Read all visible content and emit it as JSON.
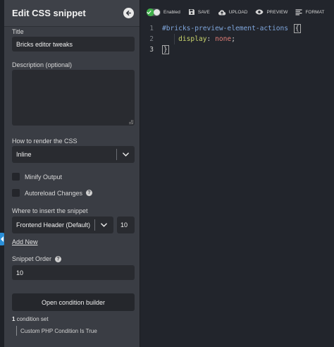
{
  "panel": {
    "title": "Edit CSS snippet",
    "title_label": "Title",
    "title_value": "Bricks editor tweaks",
    "description_label": "Description (optional)",
    "description_value": "",
    "render_label": "How to render the CSS",
    "render_value": "Inline",
    "minify_label": "Minify Output",
    "autoreload_label": "Autoreload Changes",
    "insert_label": "Where to insert the snippet",
    "insert_value": "Frontend Header (Default)",
    "insert_priority": "10",
    "add_new": "Add New",
    "order_label": "Snippet Order",
    "order_value": "10",
    "condition_button": "Open condition builder",
    "condition_count": "1",
    "condition_count_suffix": " condition set",
    "condition_item": "Custom PHP Condition Is True",
    "help_glyph": "?"
  },
  "toolbar": {
    "enabled_label": "Enabled",
    "enabled": true,
    "save_label": "SAVE",
    "upload_label": "UPLOAD",
    "preview_label": "PREVIEW",
    "format_label": "FORMAT"
  },
  "code": {
    "line_numbers": [
      "1",
      "2",
      "3"
    ],
    "selector": "#bricks-preview-element-actions",
    "open_brace": "{",
    "indent": "    ",
    "property": "display",
    "colon": ":",
    "value": "none",
    "semicolon": ";",
    "close_brace": "}"
  },
  "colors": {
    "accent_green": "#3fae49",
    "edge_tab_blue": "#2a8fd8",
    "selector": "#7fa6dc",
    "property": "#c8d36b",
    "value": "#e07d76"
  },
  "icons": [
    "back-arrow-icon",
    "save-icon",
    "upload-cloud-icon",
    "eye-icon",
    "format-lines-icon",
    "chevron-down-icon",
    "help-icon",
    "checkmark-icon",
    "chevron-left-icon"
  ]
}
